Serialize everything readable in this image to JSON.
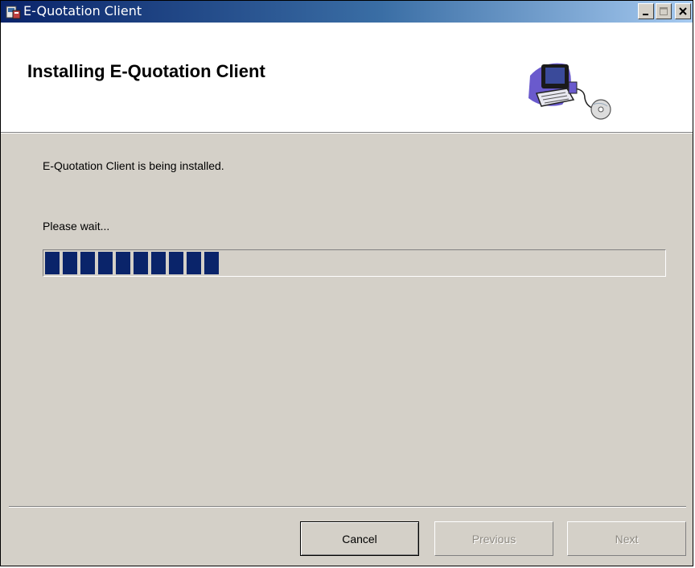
{
  "window": {
    "title": "E-Quotation Client",
    "controls": {
      "minimize_icon": "minimize-icon",
      "maximize_icon": "maximize-icon",
      "close_icon": "close-icon"
    }
  },
  "header": {
    "title": "Installing E-Quotation Client",
    "illustration": "computer-cd-icon"
  },
  "body": {
    "status_text": "E-Quotation Client is being installed.",
    "wait_text": "Please wait...",
    "progress": {
      "value_percent": 29,
      "color": "#0a246a"
    }
  },
  "footer": {
    "cancel_label": "Cancel",
    "previous_label": "Previous",
    "next_label": "Next"
  },
  "colors": {
    "titlebar_start": "#0a246a",
    "titlebar_end": "#a6caf0",
    "dialog_bg": "#d4d0c8"
  }
}
